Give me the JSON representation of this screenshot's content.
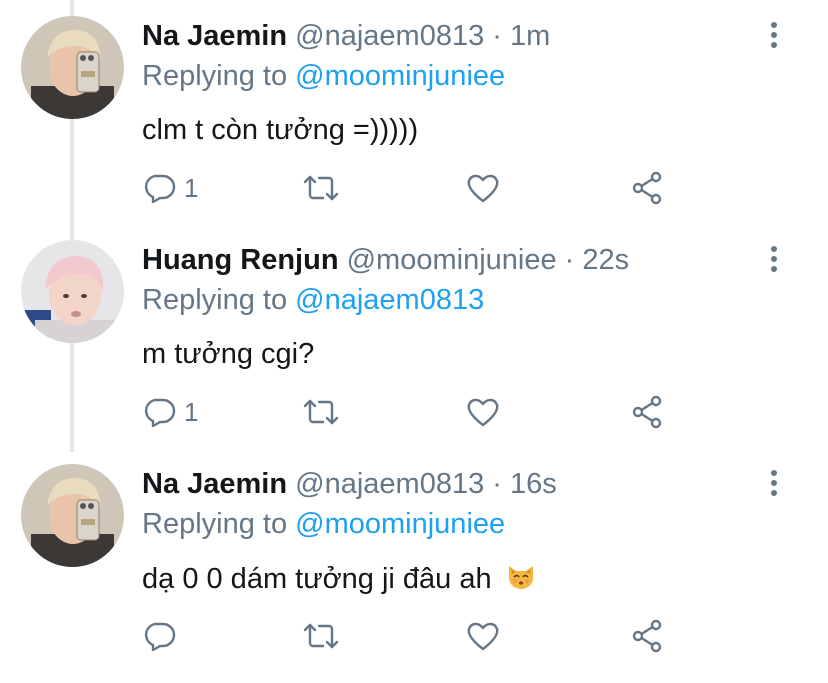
{
  "tweets": [
    {
      "name": "Na Jaemin",
      "handle": "@najaem0813",
      "separator": "·",
      "time": "1m",
      "replying_prefix": "Replying to",
      "replying_handle": "@moominjuniee",
      "text": "clm t còn tưởng =)))))",
      "reply_count": "1",
      "avatar_icon": "avatar-blonde",
      "avatar_colors": {
        "hair": "#e9dcbc",
        "bg": "#cfc6b8",
        "skin": "#e8c4a8",
        "jacket": "#3c3836"
      }
    },
    {
      "name": "Huang Renjun",
      "handle": "@moominjuniee",
      "separator": "·",
      "time": "22s",
      "replying_prefix": "Replying to",
      "replying_handle": "@najaem0813",
      "text": "m tưởng cgi?",
      "reply_count": "1",
      "avatar_icon": "avatar-pink-hair",
      "avatar_colors": {
        "hair": "#f1c9cf",
        "bg": "#e7e5e8",
        "skin": "#f2d5c8"
      }
    },
    {
      "name": "Na Jaemin",
      "handle": "@najaem0813",
      "separator": "·",
      "time": "16s",
      "replying_prefix": "Replying to",
      "replying_handle": "@moominjuniee",
      "text": "dạ 0 0 dám tưởng ji đâu ah",
      "reply_count": "",
      "emoji_icon": "kissing-cat-face-emoji",
      "avatar_icon": "avatar-blonde",
      "avatar_colors": {
        "hair": "#e9dcbc",
        "bg": "#cfc6b8",
        "skin": "#e8c4a8",
        "jacket": "#3c3836"
      }
    }
  ],
  "icons": {
    "reply": "reply-icon",
    "retweet": "retweet-icon",
    "like": "heart-icon",
    "share": "share-icon",
    "menu": "more-options-icon"
  },
  "colors": {
    "link": "#1da1f2",
    "secondary": "#657786",
    "primary": "#14171a",
    "thread_line": "#e1e8ed"
  }
}
